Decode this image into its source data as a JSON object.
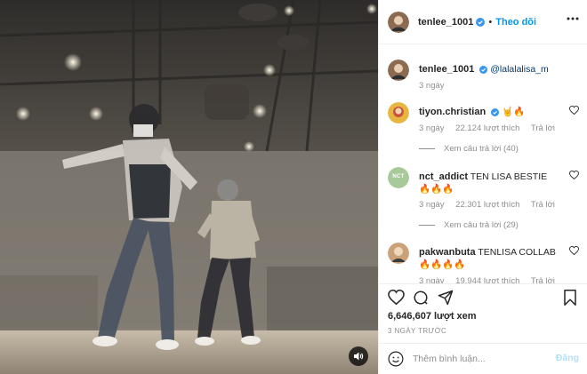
{
  "header": {
    "username": "tenlee_1001",
    "follow_label": "Theo dõi"
  },
  "caption": {
    "username": "tenlee_1001",
    "mention": "@lalalalisa_m",
    "time": "3 ngày"
  },
  "comments": [
    {
      "username": "tiyon.christian",
      "text": "🤘🔥",
      "time": "3 ngày",
      "likes": "22.124 lượt thích",
      "reply_label": "Trả lời",
      "view_replies": "Xem câu trả lời (40)",
      "avatar_color": "#e7b542"
    },
    {
      "username": "nct_addict",
      "text": "TEN LISA BESTIE 🔥🔥🔥",
      "time": "3 ngày",
      "likes": "22.301 lượt thích",
      "reply_label": "Trả lời",
      "view_replies": "Xem câu trả lời (29)",
      "avatar_label": "NCT",
      "avatar_color": "#a8c99a"
    },
    {
      "username": "pakwanbuta",
      "text": "TENLISA COLLAB🔥🔥🔥🔥",
      "time": "3 ngày",
      "likes": "19.944 lượt thích",
      "reply_label": "Trả lời",
      "avatar_color": "#c9a27a"
    }
  ],
  "stats": {
    "views": "6,646,607 lượt xem",
    "date": "3 NGÀY TRƯỚC"
  },
  "comment_box": {
    "placeholder": "Thêm bình luận...",
    "post_label": "Đăng"
  },
  "colors": {
    "accent": "#0095f6",
    "verified": "#3897f0",
    "muted": "#8e8e8e",
    "post_disabled": "#b2dffc"
  },
  "icons": {
    "verified": "verified-badge-icon",
    "more": "more-options-icon",
    "heart": "heart-icon",
    "comment": "comment-icon",
    "share": "share-icon",
    "save": "bookmark-icon",
    "emoji": "emoji-icon",
    "sound": "speaker-icon"
  }
}
